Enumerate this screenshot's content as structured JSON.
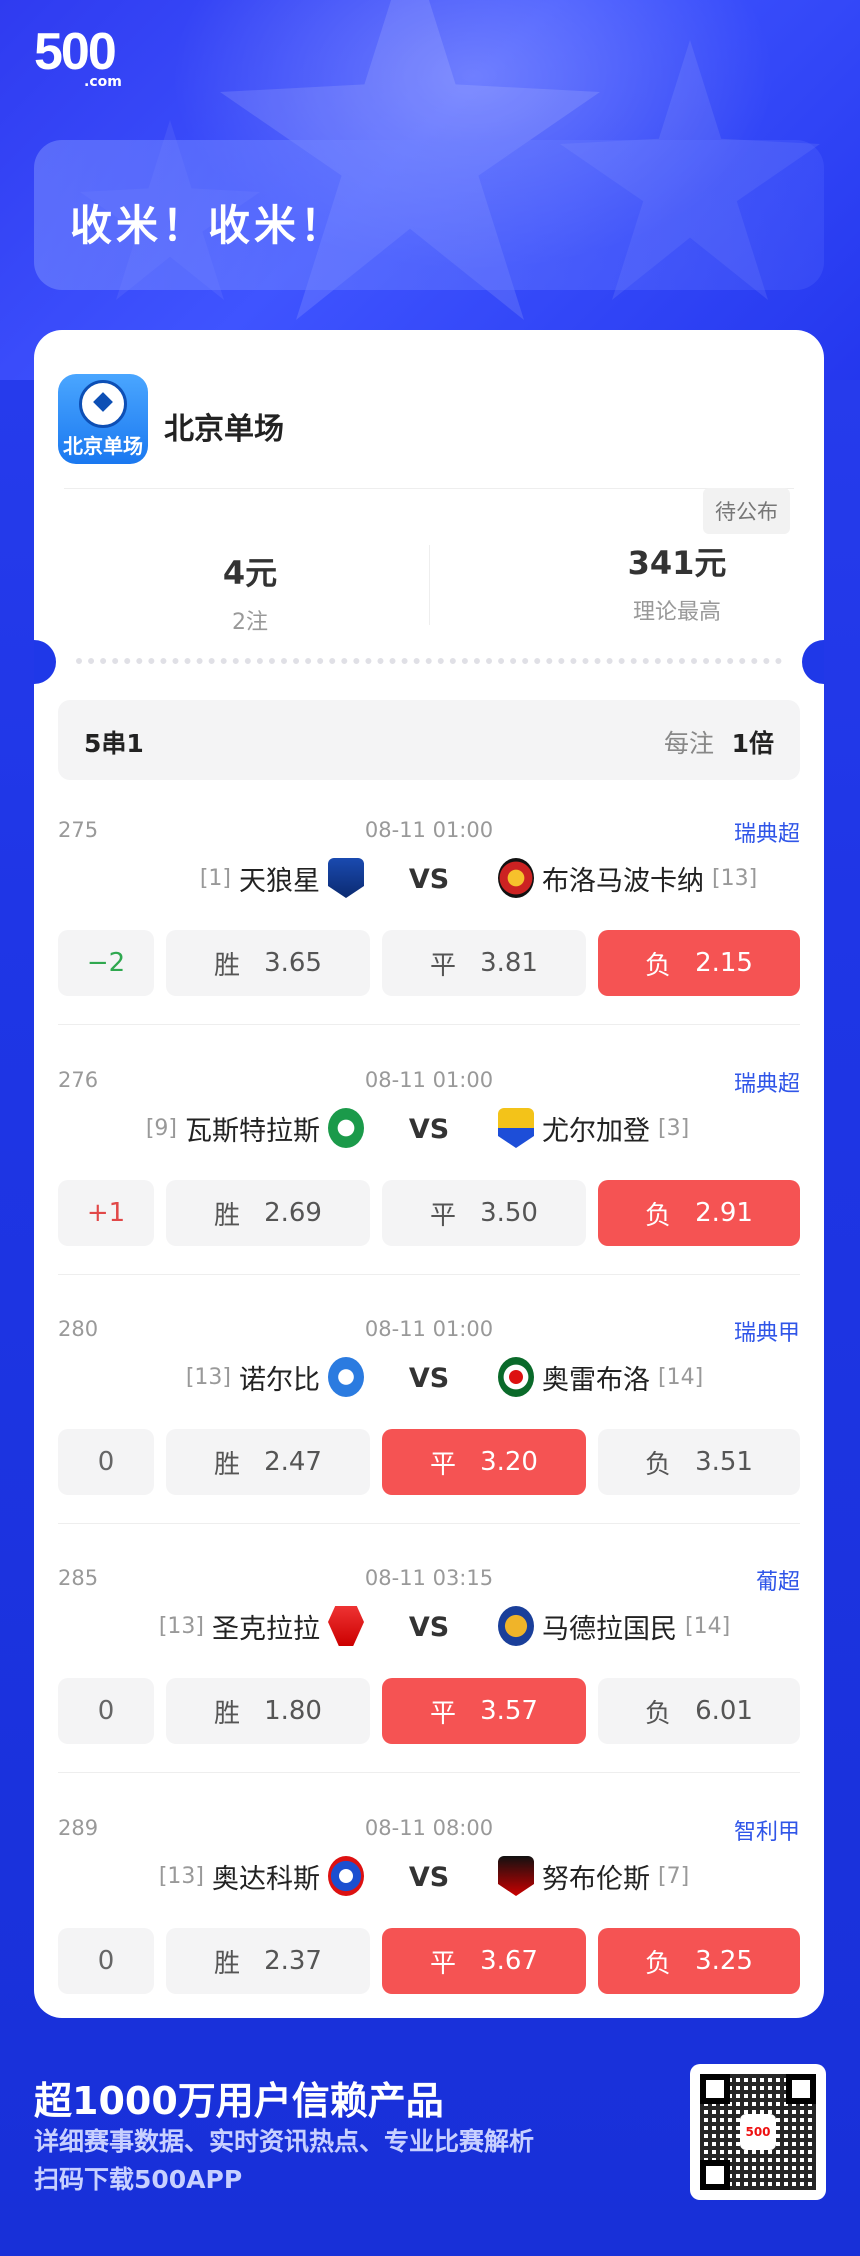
{
  "brand": {
    "logo_main": "500",
    "logo_sub": ".com"
  },
  "banner": {
    "title": "收米！收米！"
  },
  "product": {
    "name": "北京单场",
    "icon_text": "北京单场",
    "status": "待公布"
  },
  "stats": {
    "stake": "4元",
    "bets": "2注",
    "max_payout": "341元",
    "max_label": "理论最高"
  },
  "bet_type": {
    "label": "5串1",
    "per_label": "每注",
    "multiplier": "1倍"
  },
  "matches": [
    {
      "num": "275",
      "time": "08-11 01:00",
      "league": "瑞典超",
      "home_rank": "[1]",
      "home": "天狼星",
      "away": "布洛马波卡纳",
      "away_rank": "[13]",
      "vs": "VS",
      "handicap": "−2",
      "win": "3.65",
      "draw": "3.81",
      "loss": "2.15",
      "win_label": "胜",
      "draw_label": "平",
      "loss_label": "负",
      "selected": [
        "loss"
      ]
    },
    {
      "num": "276",
      "time": "08-11 01:00",
      "league": "瑞典超",
      "home_rank": "[9]",
      "home": "瓦斯特拉斯",
      "away": "尤尔加登",
      "away_rank": "[3]",
      "vs": "VS",
      "handicap": "+1",
      "win": "2.69",
      "draw": "3.50",
      "loss": "2.91",
      "win_label": "胜",
      "draw_label": "平",
      "loss_label": "负",
      "selected": [
        "loss"
      ]
    },
    {
      "num": "280",
      "time": "08-11 01:00",
      "league": "瑞典甲",
      "home_rank": "[13]",
      "home": "诺尔比",
      "away": "奥雷布洛",
      "away_rank": "[14]",
      "vs": "VS",
      "handicap": "0",
      "win": "2.47",
      "draw": "3.20",
      "loss": "3.51",
      "win_label": "胜",
      "draw_label": "平",
      "loss_label": "负",
      "selected": [
        "draw"
      ]
    },
    {
      "num": "285",
      "time": "08-11 03:15",
      "league": "葡超",
      "home_rank": "[13]",
      "home": "圣克拉拉",
      "away": "马德拉国民",
      "away_rank": "[14]",
      "vs": "VS",
      "handicap": "0",
      "win": "1.80",
      "draw": "3.57",
      "loss": "6.01",
      "win_label": "胜",
      "draw_label": "平",
      "loss_label": "负",
      "selected": [
        "draw"
      ]
    },
    {
      "num": "289",
      "time": "08-11 08:00",
      "league": "智利甲",
      "home_rank": "[13]",
      "home": "奥达科斯",
      "away": "努布伦斯",
      "away_rank": "[7]",
      "vs": "VS",
      "handicap": "0",
      "win": "2.37",
      "draw": "3.67",
      "loss": "3.25",
      "win_label": "胜",
      "draw_label": "平",
      "loss_label": "负",
      "selected": [
        "draw",
        "loss"
      ]
    }
  ],
  "footer": {
    "title": "超1000万用户信赖产品",
    "line1": "详细赛事数据、实时资讯热点、专业比赛解析",
    "line2": "扫码下载500APP",
    "qr_center": "500"
  },
  "colors": {
    "accent": "#2f55e8",
    "selected": "#f55353",
    "bg": "#1f36e6"
  }
}
